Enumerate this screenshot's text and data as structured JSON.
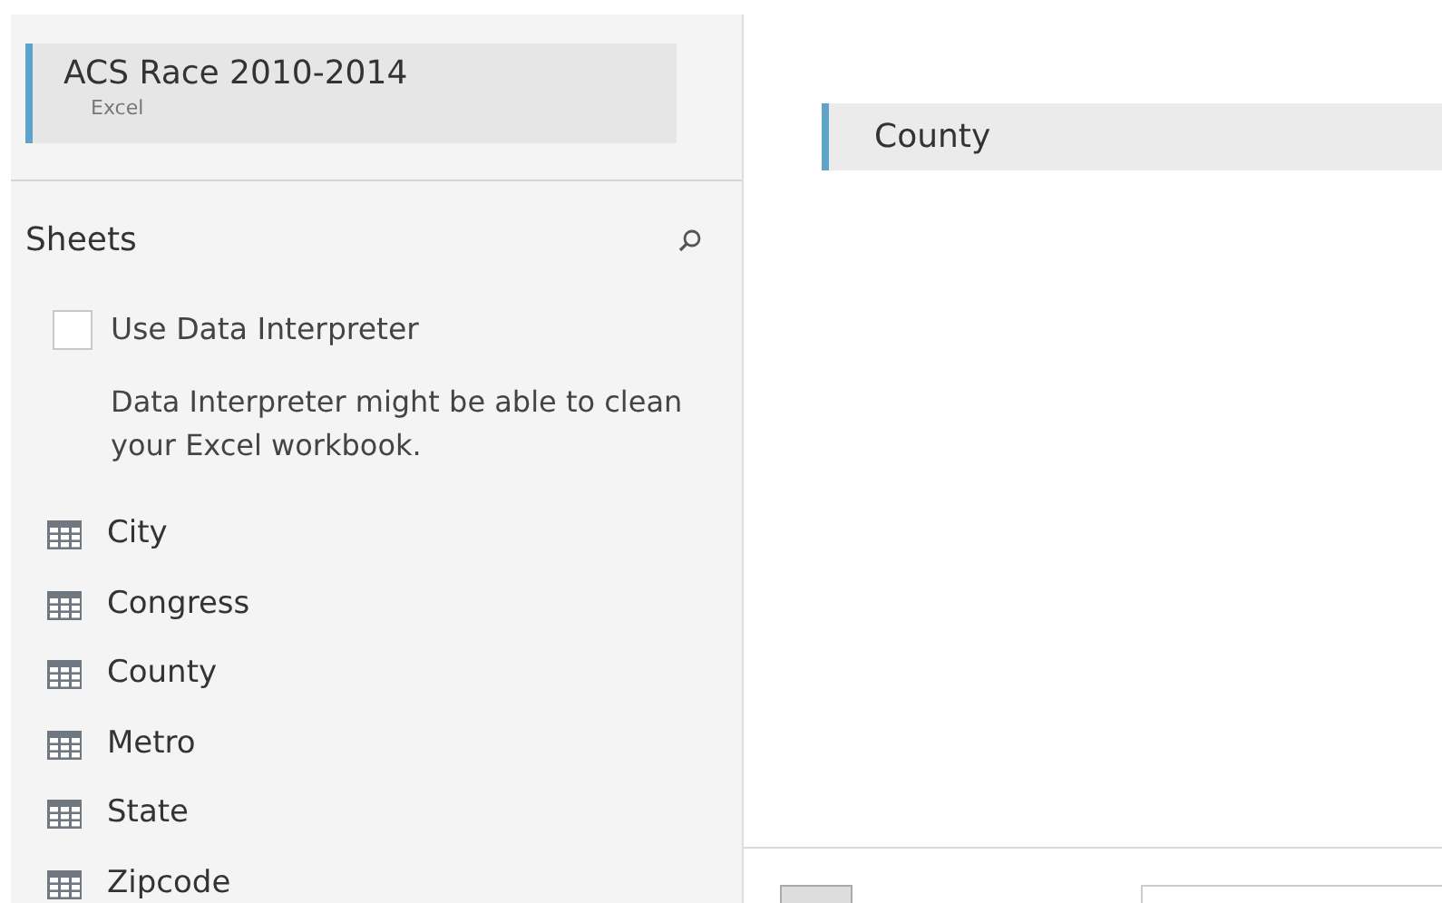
{
  "connection": {
    "name": "ACS Race 2010-2014",
    "type": "Excel"
  },
  "sheets": {
    "title": "Sheets",
    "interpreter": {
      "label": "Use Data Interpreter",
      "checked": false,
      "hint": "Data Interpreter might be able to clean your Excel workbook."
    },
    "items": [
      {
        "label": "City"
      },
      {
        "label": "Congress"
      },
      {
        "label": "County"
      },
      {
        "label": "Metro"
      },
      {
        "label": "State"
      },
      {
        "label": "Zipcode"
      }
    ]
  },
  "canvas": {
    "tables": [
      {
        "label": "County"
      }
    ]
  }
}
